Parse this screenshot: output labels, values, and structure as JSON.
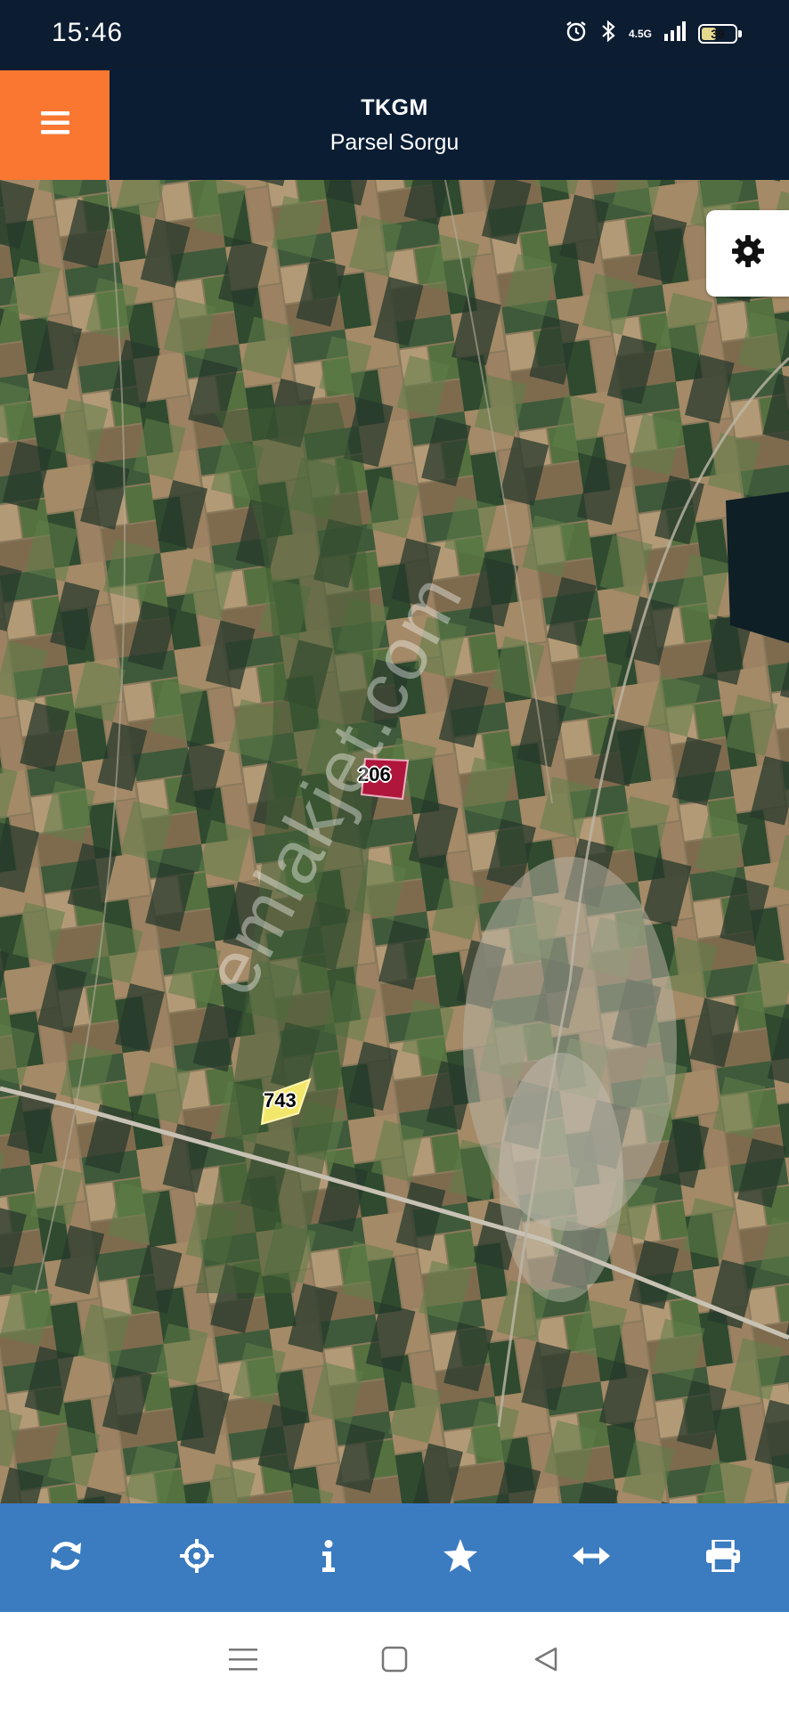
{
  "status_bar": {
    "time": "15:46",
    "network": "4.5G",
    "battery": "39",
    "icons": [
      "alarm-icon",
      "bluetooth-icon",
      "signal-icon",
      "battery-icon"
    ]
  },
  "header": {
    "title": "TKGM",
    "subtitle": "Parsel Sorgu",
    "menu_icon": "hamburger-icon",
    "accent_color": "#f97731",
    "bar_color": "#0a1d33"
  },
  "map": {
    "settings_icon": "gear-icon",
    "parcels": [
      {
        "label": "206",
        "color": "#b0163c"
      },
      {
        "label": "743",
        "color": "#f2e76b"
      }
    ],
    "watermark": "emlakjet.com"
  },
  "toolbar": {
    "color": "#3b7bc0",
    "tools": [
      {
        "name": "refresh",
        "icon": "refresh-icon"
      },
      {
        "name": "locate",
        "icon": "crosshair-icon"
      },
      {
        "name": "info",
        "icon": "info-icon"
      },
      {
        "name": "favorite",
        "icon": "star-icon"
      },
      {
        "name": "measure",
        "icon": "arrows-horizontal-icon"
      },
      {
        "name": "print",
        "icon": "printer-icon"
      }
    ]
  },
  "system_nav": [
    "recents-icon",
    "home-icon",
    "back-icon"
  ]
}
